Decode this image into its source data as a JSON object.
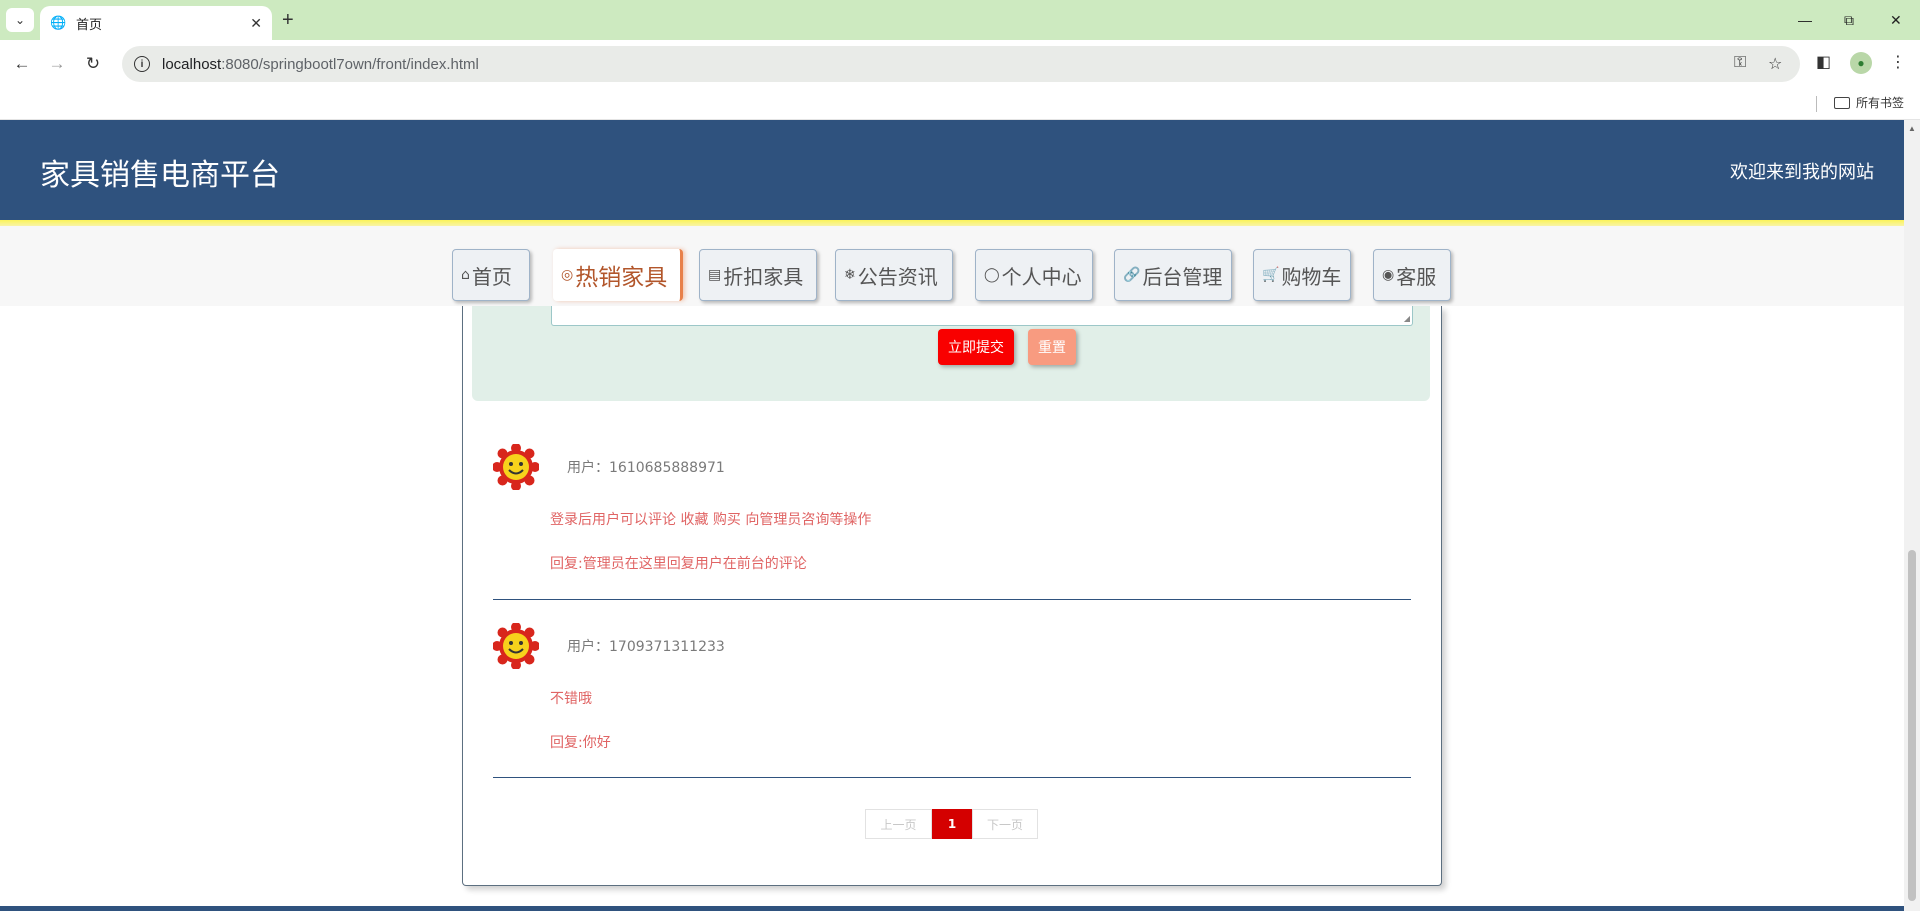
{
  "browser": {
    "tab_title": "首页",
    "url_host": "localhost",
    "url_path": ":8080/springbootl7own/front/index.html",
    "bookmarks_folder": "所有书签"
  },
  "site": {
    "title": "家具销售电商平台",
    "welcome": "欢迎来到我的网站"
  },
  "nav": [
    {
      "label": "首页",
      "icon": "home-icon"
    },
    {
      "label": "热销家具",
      "icon": "hot-icon"
    },
    {
      "label": "折扣家具",
      "icon": "gift-icon"
    },
    {
      "label": "公告资讯",
      "icon": "snowflake-icon"
    },
    {
      "label": "个人中心",
      "icon": "user-icon"
    },
    {
      "label": "后台管理",
      "icon": "link-icon"
    },
    {
      "label": "购物车",
      "icon": "cart-icon"
    },
    {
      "label": "客服",
      "icon": "chat-icon"
    }
  ],
  "form": {
    "submit_label": "立即提交",
    "reset_label": "重置"
  },
  "comments": [
    {
      "user": "用户：1610685888971",
      "content": "登录后用户可以评论 收藏 购买 向管理员咨询等操作",
      "reply": "回复:管理员在这里回复用户在前台的评论"
    },
    {
      "user": "用户：1709371311233",
      "content": "不错哦",
      "reply": "回复:你好"
    }
  ],
  "pager": {
    "prev_label": "上一页",
    "current": "1",
    "next_label": "下一页"
  },
  "colors": {
    "header": "#2f527e",
    "accent_red": "#f90000",
    "comment_text": "#e06464"
  }
}
